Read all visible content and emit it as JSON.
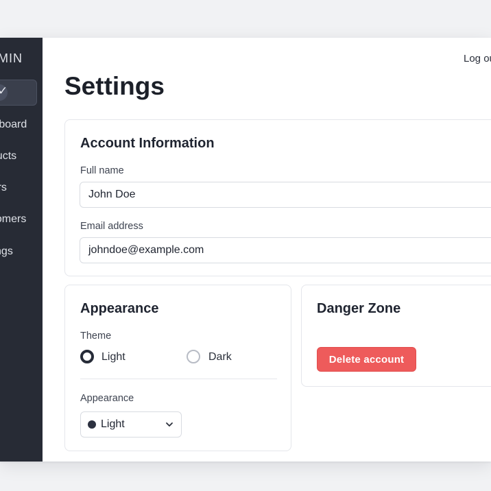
{
  "app": {
    "brand": "ADMIN"
  },
  "sidebar": {
    "items": [
      {
        "label": "Dashboard"
      },
      {
        "label": "Products"
      },
      {
        "label": "Orders"
      },
      {
        "label": "Customers"
      },
      {
        "label": "Settings"
      }
    ]
  },
  "header": {
    "logout_label": "Log out"
  },
  "page": {
    "title": "Settings"
  },
  "account": {
    "title": "Account Information",
    "full_name_label": "Full name",
    "full_name_value": "John Doe",
    "email_label": "Email address",
    "email_value": "johndoe@example.com"
  },
  "appearance": {
    "title": "Appearance",
    "theme_label": "Theme",
    "options": [
      {
        "label": "Light",
        "selected": true
      },
      {
        "label": "Dark",
        "selected": false
      }
    ],
    "select_label": "Appearance",
    "select_value": "Light"
  },
  "danger": {
    "title": "Danger Zone",
    "button_label": "Delete account",
    "button_color": "#ee5b5b"
  },
  "colors": {
    "sidebar": "#272b35",
    "accent": "#262b38"
  }
}
